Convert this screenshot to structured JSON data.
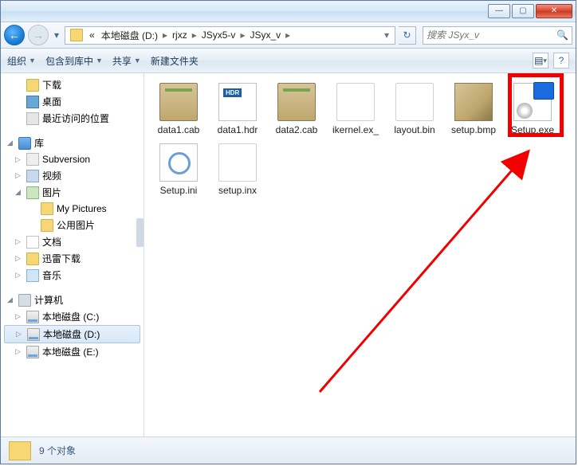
{
  "titlebar": {},
  "breadcrumb": {
    "prefix": "«",
    "items": [
      "本地磁盘 (D:)",
      "rjxz",
      "JSyx5-v",
      "JSyx_v"
    ]
  },
  "search": {
    "placeholder": "搜索 JSyx_v"
  },
  "toolbar": {
    "organize": "组织",
    "include": "包含到库中",
    "share": "共享",
    "newfolder": "新建文件夹"
  },
  "tree": {
    "downloads": "下载",
    "desktop": "桌面",
    "recent": "最近访问的位置",
    "lib": "库",
    "subversion": "Subversion",
    "video": "视频",
    "pictures": "图片",
    "mypictures": "My Pictures",
    "publicpics": "公用图片",
    "documents": "文档",
    "thunder": "迅雷下载",
    "music": "音乐",
    "computer": "计算机",
    "driveC": "本地磁盘 (C:)",
    "driveD": "本地磁盘 (D:)",
    "driveE": "本地磁盘 (E:)"
  },
  "files": [
    {
      "name": "data1.cab",
      "icon": "cab"
    },
    {
      "name": "data1.hdr",
      "icon": "hdr"
    },
    {
      "name": "data2.cab",
      "icon": "cab"
    },
    {
      "name": "ikernel.ex_",
      "icon": "blank"
    },
    {
      "name": "layout.bin",
      "icon": "blank"
    },
    {
      "name": "setup.bmp",
      "icon": "bmp"
    },
    {
      "name": "Setup.exe",
      "icon": "exe"
    },
    {
      "name": "Setup.ini",
      "icon": "ini"
    },
    {
      "name": "setup.inx",
      "icon": "blank"
    }
  ],
  "status": {
    "text": "9 个对象"
  }
}
